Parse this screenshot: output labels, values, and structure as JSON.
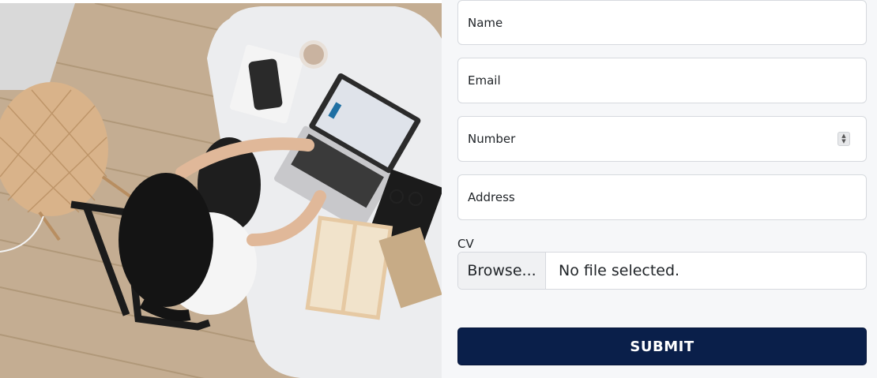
{
  "hero": {
    "image": "woman-working-on-laptop-photo"
  },
  "form": {
    "name_placeholder": "Name",
    "email_placeholder": "Email",
    "number_placeholder": "Number",
    "address_placeholder": "Address",
    "cv_label": "CV",
    "browse_label": "Browse...",
    "file_status": "No file selected.",
    "submit_label": "SUBMIT"
  },
  "colors": {
    "panel_background": "#f6f7f9",
    "submit_background": "#0a1f4a",
    "submit_text": "#ffffff",
    "input_border": "#d6d9de"
  }
}
